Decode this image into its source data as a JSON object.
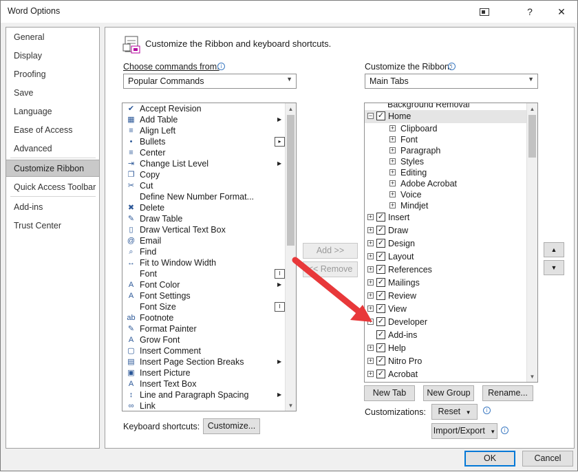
{
  "window": {
    "title": "Word Options",
    "restore_icon": "restore-icon",
    "help_label": "?",
    "close_label": "✕"
  },
  "nav": {
    "items": [
      {
        "label": "General"
      },
      {
        "label": "Display"
      },
      {
        "label": "Proofing"
      },
      {
        "label": "Save"
      },
      {
        "label": "Language"
      },
      {
        "label": "Ease of Access"
      },
      {
        "label": "Advanced"
      },
      {
        "label": "Customize Ribbon"
      },
      {
        "label": "Quick Access Toolbar"
      },
      {
        "label": "Add-ins"
      },
      {
        "label": "Trust Center"
      }
    ],
    "selected": "Customize Ribbon"
  },
  "header": {
    "title": "Customize the Ribbon and keyboard shortcuts."
  },
  "left": {
    "choose_label": "Choose commands from:",
    "choose_value": "Popular Commands",
    "commands": [
      {
        "label": "Accept Revision",
        "sub": ""
      },
      {
        "label": "Add Table",
        "sub": "arrow"
      },
      {
        "label": "Align Left",
        "sub": ""
      },
      {
        "label": "Bullets",
        "sub": "split"
      },
      {
        "label": "Center",
        "sub": ""
      },
      {
        "label": "Change List Level",
        "sub": "arrow"
      },
      {
        "label": "Copy",
        "sub": ""
      },
      {
        "label": "Cut",
        "sub": ""
      },
      {
        "label": "Define New Number Format...",
        "sub": ""
      },
      {
        "label": "Delete",
        "sub": ""
      },
      {
        "label": "Draw Table",
        "sub": ""
      },
      {
        "label": "Draw Vertical Text Box",
        "sub": ""
      },
      {
        "label": "Email",
        "sub": ""
      },
      {
        "label": "Find",
        "sub": ""
      },
      {
        "label": "Fit to Window Width",
        "sub": ""
      },
      {
        "label": "Font",
        "sub": "box"
      },
      {
        "label": "Font Color",
        "sub": "arrow"
      },
      {
        "label": "Font Settings",
        "sub": ""
      },
      {
        "label": "Font Size",
        "sub": "box"
      },
      {
        "label": "Footnote",
        "sub": ""
      },
      {
        "label": "Format Painter",
        "sub": ""
      },
      {
        "label": "Grow Font",
        "sub": ""
      },
      {
        "label": "Insert Comment",
        "sub": ""
      },
      {
        "label": "Insert Page  Section Breaks",
        "sub": "arrow"
      },
      {
        "label": "Insert Picture",
        "sub": ""
      },
      {
        "label": "Insert Text Box",
        "sub": ""
      },
      {
        "label": "Line and Paragraph Spacing",
        "sub": "arrow"
      },
      {
        "label": "Link",
        "sub": ""
      }
    ],
    "icons": [
      "accept-revision-icon",
      "add-table-icon",
      "align-left-icon",
      "bullets-icon",
      "center-icon",
      "change-list-level-icon",
      "copy-icon",
      "cut-icon",
      "define-number-format-icon",
      "delete-icon",
      "draw-table-icon",
      "draw-vertical-text-box-icon",
      "email-icon",
      "find-icon",
      "fit-to-window-width-icon",
      "font-icon",
      "font-color-icon",
      "font-settings-icon",
      "font-size-icon",
      "footnote-icon",
      "format-painter-icon",
      "grow-font-icon",
      "insert-comment-icon",
      "insert-page-section-breaks-icon",
      "insert-picture-icon",
      "insert-text-box-icon",
      "line-paragraph-spacing-icon",
      "link-icon"
    ],
    "keyboard_label": "Keyboard shortcuts:",
    "customize_button": "Customize..."
  },
  "middle": {
    "add_button": "Add >>",
    "remove_button": "<< Remove"
  },
  "right": {
    "ribbon_label": "Customize the Ribbon:",
    "ribbon_value": "Main Tabs",
    "partial_top": "Background Removal",
    "tree": [
      {
        "label": "Home",
        "level": 0,
        "expander": "−",
        "checked": true,
        "selected": true
      },
      {
        "label": "Clipboard",
        "level": 1,
        "expander": "+",
        "checked": null
      },
      {
        "label": "Font",
        "level": 1,
        "expander": "+",
        "checked": null
      },
      {
        "label": "Paragraph",
        "level": 1,
        "expander": "+",
        "checked": null
      },
      {
        "label": "Styles",
        "level": 1,
        "expander": "+",
        "checked": null
      },
      {
        "label": "Editing",
        "level": 1,
        "expander": "+",
        "checked": null
      },
      {
        "label": "Adobe Acrobat",
        "level": 1,
        "expander": "+",
        "checked": null
      },
      {
        "label": "Voice",
        "level": 1,
        "expander": "+",
        "checked": null
      },
      {
        "label": "Mindjet",
        "level": 1,
        "expander": "+",
        "checked": null
      },
      {
        "label": "Insert",
        "level": 0,
        "expander": "+",
        "checked": true
      },
      {
        "label": "Draw",
        "level": 0,
        "expander": "+",
        "checked": true
      },
      {
        "label": "Design",
        "level": 0,
        "expander": "+",
        "checked": true
      },
      {
        "label": "Layout",
        "level": 0,
        "expander": "+",
        "checked": true
      },
      {
        "label": "References",
        "level": 0,
        "expander": "+",
        "checked": true
      },
      {
        "label": "Mailings",
        "level": 0,
        "expander": "+",
        "checked": true
      },
      {
        "label": "Review",
        "level": 0,
        "expander": "+",
        "checked": true
      },
      {
        "label": "View",
        "level": 0,
        "expander": "+",
        "checked": true
      },
      {
        "label": "Developer",
        "level": 0,
        "expander": "+",
        "checked": true
      },
      {
        "label": "Add-ins",
        "level": 0,
        "expander": "",
        "checked": true
      },
      {
        "label": "Help",
        "level": 0,
        "expander": "+",
        "checked": true
      },
      {
        "label": "Nitro Pro",
        "level": 0,
        "expander": "+",
        "checked": true
      },
      {
        "label": "Acrobat",
        "level": 0,
        "expander": "+",
        "checked": true
      }
    ],
    "new_tab": "New Tab",
    "new_group": "New Group",
    "rename": "Rename...",
    "customizations_label": "Customizations:",
    "reset_button": "Reset",
    "import_export_button": "Import/Export",
    "move_up_icon": "up-arrow-icon",
    "move_down_icon": "down-arrow-icon"
  },
  "footer": {
    "ok": "OK",
    "cancel": "Cancel"
  },
  "colors": {
    "accent": "#0078d7",
    "annotation_arrow": "#e8383a",
    "selected_nav": "#c9c9c9"
  }
}
